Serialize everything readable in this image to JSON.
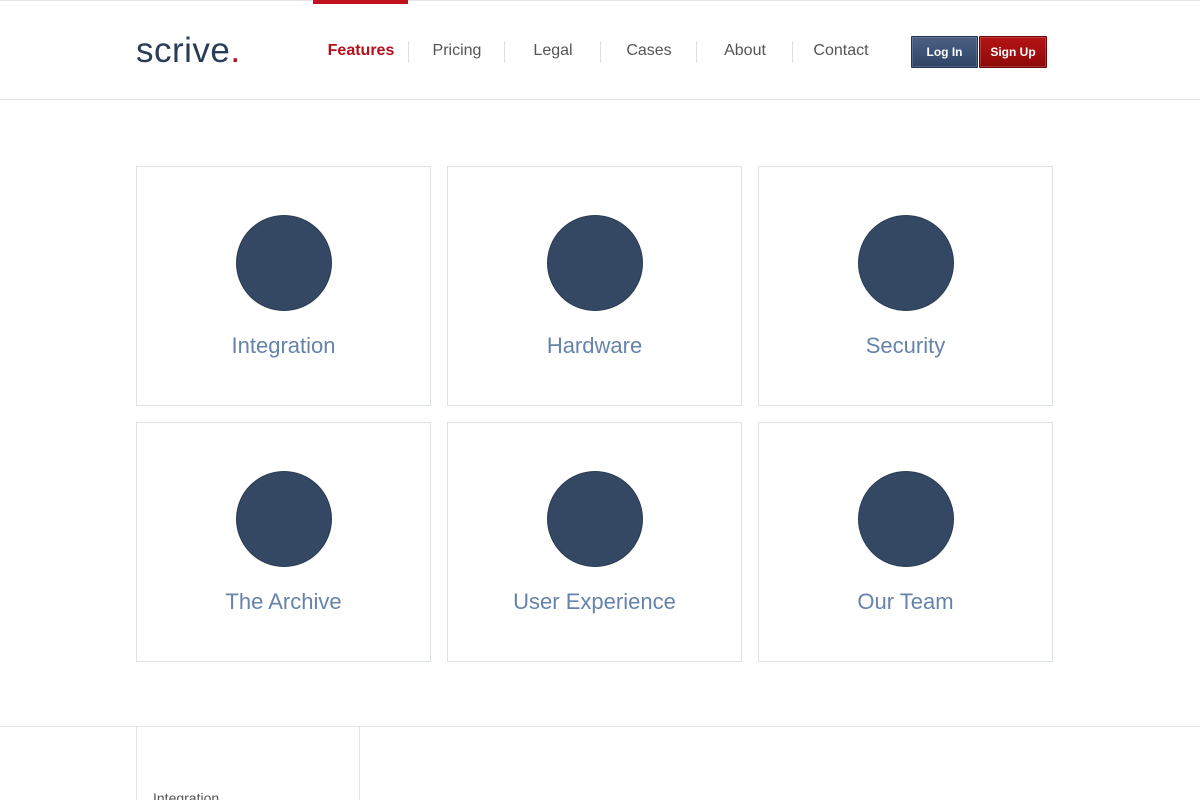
{
  "logo": {
    "text": "scrive",
    "dot": "."
  },
  "nav": {
    "items": [
      {
        "label": "Features",
        "active": true
      },
      {
        "label": "Pricing"
      },
      {
        "label": "Legal"
      },
      {
        "label": "Cases"
      },
      {
        "label": "About"
      },
      {
        "label": "Contact"
      }
    ]
  },
  "buttons": {
    "login_label": "Log In",
    "signup_label": "Sign Up"
  },
  "features": {
    "cards": [
      {
        "title": "Integration"
      },
      {
        "title": "Hardware"
      },
      {
        "title": "Security"
      },
      {
        "title": "The Archive"
      },
      {
        "title": "User Experience"
      },
      {
        "title": "Our Team"
      }
    ]
  },
  "subnav": {
    "items": [
      {
        "label": "Integration"
      }
    ]
  },
  "colors": {
    "brand_navy": "#2a3c58",
    "brand_red": "#b4101a",
    "card_circle": "#344863",
    "card_title": "#6683ac"
  }
}
